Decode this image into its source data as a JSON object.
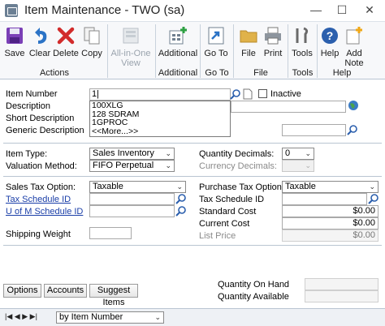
{
  "window": {
    "title": "Item Maintenance  -  TWO (sa)",
    "minimize": "—",
    "maximize": "☐",
    "close": "✕"
  },
  "ribbon": {
    "buttons": [
      {
        "label": "Save"
      },
      {
        "label": "Clear"
      },
      {
        "label": "Delete"
      },
      {
        "label": "Copy"
      },
      {
        "label": "All-in-One View"
      },
      {
        "label": "Additional"
      },
      {
        "label": "Go To"
      },
      {
        "label": "File"
      },
      {
        "label": "Print"
      },
      {
        "label": "Tools"
      },
      {
        "label": "Help"
      },
      {
        "label": "Add Note"
      }
    ],
    "groups": [
      "Actions",
      "Additional",
      "Go To",
      "File",
      "Tools",
      "Help"
    ]
  },
  "form": {
    "item_number_label": "Item Number",
    "item_number_value": "1|",
    "inactive_label": "Inactive",
    "description_label": "Description",
    "short_description_label": "Short Description",
    "generic_description_label": "Generic Description",
    "suggestions": [
      "100XLG",
      "128 SDRAM",
      "1GPROC",
      "<<More...>>"
    ],
    "item_type_label": "Item Type:",
    "item_type_value": "Sales Inventory",
    "valuation_method_label": "Valuation Method:",
    "valuation_method_value": "FIFO Perpetual",
    "quantity_decimals_label": "Quantity Decimals:",
    "quantity_decimals_value": "0",
    "currency_decimals_label": "Currency Decimals:",
    "sales_tax_option_label": "Sales Tax Option:",
    "sales_tax_option_value": "Taxable",
    "purchase_tax_option_label": "Purchase Tax Option:",
    "purchase_tax_option_value": "Taxable",
    "tax_schedule_id_label": "Tax Schedule ID",
    "uofm_schedule_id_label": "U of M Schedule ID",
    "purchase_tax_schedule_id_label": "Tax Schedule ID",
    "standard_cost_label": "Standard Cost",
    "standard_cost_value": "$0.00",
    "current_cost_label": "Current Cost",
    "current_cost_value": "$0.00",
    "list_price_label": "List Price",
    "list_price_value": "$0.00",
    "shipping_weight_label": "Shipping Weight",
    "quantity_on_hand_label": "Quantity On Hand",
    "quantity_available_label": "Quantity Available"
  },
  "bottom_buttons": {
    "options": "Options",
    "accounts": "Accounts",
    "suggest_items": "Suggest Items"
  },
  "statusbar": {
    "sort_value": "by Item Number"
  },
  "colors": {
    "link": "#1a3ea8",
    "ribbon_bg": "#f7f8fa",
    "accent_blue": "#2b73c6"
  }
}
